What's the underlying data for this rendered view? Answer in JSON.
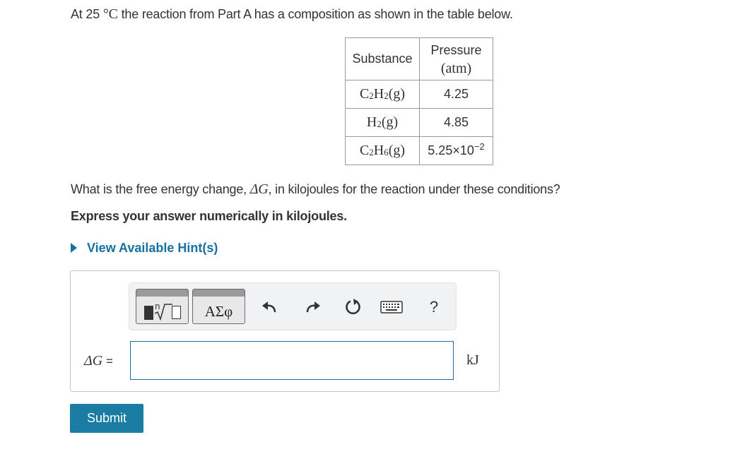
{
  "intro": {
    "text_before": "At 25 ",
    "math": "°C",
    "text_after": " the reaction from Part A has a composition as shown in the table below."
  },
  "table": {
    "headers": {
      "substance": "Substance",
      "pressure": "Pressure",
      "pressure_unit": "(atm)"
    },
    "rows": [
      {
        "formula": {
          "a": "C",
          "a_sub": "2",
          "b": "H",
          "b_sub": "2",
          "phase": "(g)"
        },
        "pressure": "4.25"
      },
      {
        "formula": {
          "a": "",
          "a_sub": "",
          "b": "H",
          "b_sub": "2",
          "phase": "(g)"
        },
        "pressure": "4.85"
      },
      {
        "formula": {
          "a": "C",
          "a_sub": "2",
          "b": "H",
          "b_sub": "6",
          "phase": "(g)"
        },
        "pressure_mantissa": "5.25×10",
        "pressure_exp": "−2"
      }
    ]
  },
  "question": {
    "text_before": "What is the free energy change, ",
    "math": "ΔG",
    "text_after": ", in kilojoules for the reaction under these conditions?"
  },
  "express": "Express your answer numerically in kilojoules.",
  "hint": "View Available Hint(s)",
  "toolbar": {
    "greek_label": "ΑΣφ",
    "help_label": "?"
  },
  "answer": {
    "label_math": "ΔG",
    "label_eq": " =",
    "value": "",
    "unit": "kJ"
  },
  "submit_label": "Submit",
  "colors": {
    "accent": "#1473a0",
    "submit_bg": "#1a7ba3",
    "text": "#333333"
  }
}
